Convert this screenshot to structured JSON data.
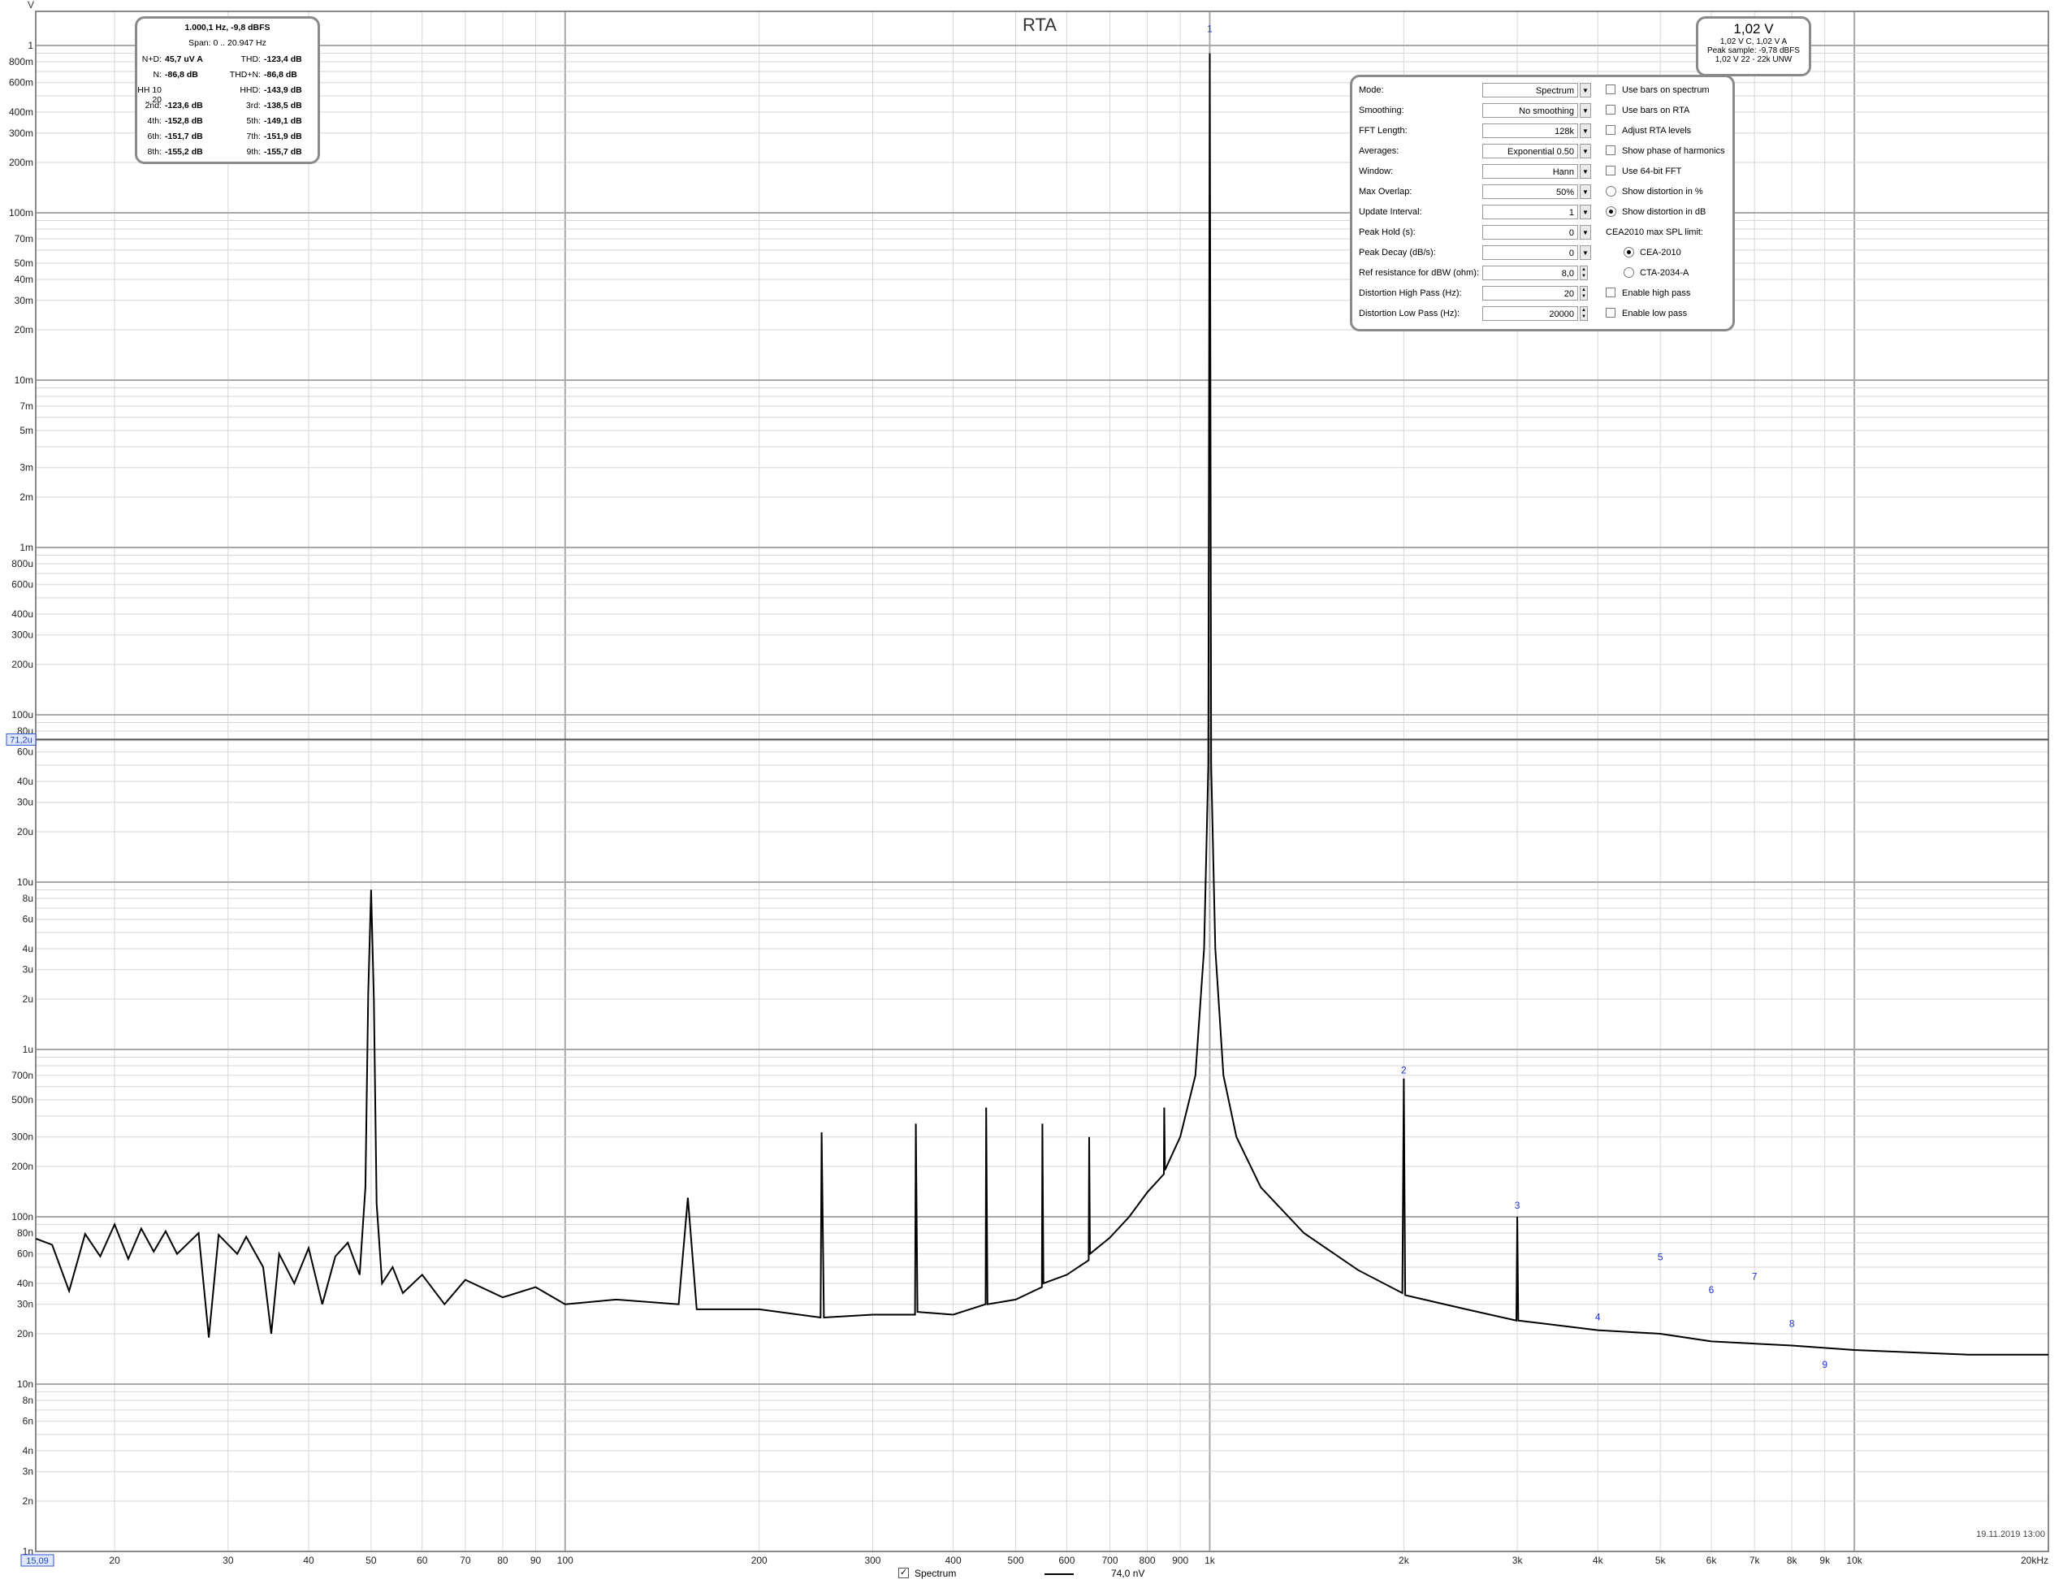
{
  "title": "RTA",
  "y_unit": "V",
  "stats": {
    "header": "1.000,1 Hz, -9,8 dBFS",
    "span": "Span:  0 .. 20.947 Hz",
    "rows": [
      [
        "N+D:",
        "45,7 uV A",
        "THD:",
        "-123,4 dB"
      ],
      [
        "N:",
        "-86,8 dB",
        "THD+N:",
        "-86,8 dB"
      ],
      [
        "HH 10 .. 20",
        "",
        "HHD:",
        "-143,9 dB"
      ],
      [
        "2nd:",
        "-123,6 dB",
        "3rd:",
        "-138,5 dB"
      ],
      [
        "4th:",
        "-152,8 dB",
        "5th:",
        "-149,1 dB"
      ],
      [
        "6th:",
        "-151,7 dB",
        "7th:",
        "-151,9 dB"
      ],
      [
        "8th:",
        "-155,2 dB",
        "9th:",
        "-155,7 dB"
      ]
    ]
  },
  "level_panel": {
    "main": "1,02 V",
    "line1": "1,02 V C, 1,02 V A",
    "line2": "Peak sample: -9,78 dBFS",
    "line3": "1,02 V 22 - 22k UNW"
  },
  "controls": {
    "rows": [
      {
        "label": "Mode:",
        "value": "Spectrum",
        "ctl": "drop",
        "opt": {
          "kind": "check",
          "label": "Use bars on spectrum",
          "on": false
        }
      },
      {
        "label": "Smoothing:",
        "value": "No  smoothing",
        "ctl": "drop",
        "opt": {
          "kind": "check",
          "label": "Use bars on RTA",
          "on": false
        }
      },
      {
        "label": "FFT Length:",
        "value": "128k",
        "ctl": "drop",
        "opt": {
          "kind": "check",
          "label": "Adjust RTA levels",
          "on": false
        }
      },
      {
        "label": "Averages:",
        "value": "Exponential 0.50",
        "ctl": "drop",
        "opt": {
          "kind": "check",
          "label": "Show phase of harmonics",
          "on": false
        }
      },
      {
        "label": "Window:",
        "value": "Hann",
        "ctl": "drop",
        "opt": {
          "kind": "check",
          "label": "Use 64-bit FFT",
          "on": false
        }
      },
      {
        "label": "Max Overlap:",
        "value": "50%",
        "ctl": "drop",
        "opt": {
          "kind": "radio",
          "label": "Show distortion in %",
          "on": false
        }
      },
      {
        "label": "Update Interval:",
        "value": "1",
        "ctl": "drop",
        "opt": {
          "kind": "radio",
          "label": "Show distortion in dB",
          "on": true
        }
      },
      {
        "label": "Peak Hold (s):",
        "value": "0",
        "ctl": "drop",
        "opt": {
          "kind": "text",
          "label": "CEA2010 max SPL limit:",
          "on": false
        }
      },
      {
        "label": "Peak Decay (dB/s):",
        "value": "0",
        "ctl": "drop",
        "opt": {
          "kind": "radio2",
          "label": "CEA-2010",
          "on": true
        }
      },
      {
        "label": "Ref resistance for dBW (ohm):",
        "value": "8,0",
        "ctl": "spin",
        "opt": {
          "kind": "radio2",
          "label": "CTA-2034-A",
          "on": false
        }
      },
      {
        "label": "Distortion High Pass (Hz):",
        "value": "20",
        "ctl": "spin",
        "opt": {
          "kind": "check",
          "label": "Enable high pass",
          "on": false
        }
      },
      {
        "label": "Distortion Low Pass (Hz):",
        "value": "20000",
        "ctl": "spin",
        "opt": {
          "kind": "check",
          "label": "Enable low pass",
          "on": false
        }
      }
    ]
  },
  "cursor": {
    "y_label": "71,2u",
    "x_label": "15,09"
  },
  "legend": {
    "checkbox_label": "Spectrum",
    "value": "74,0 nV"
  },
  "timestamp": "19.11.2019 13:00",
  "chart_data": {
    "type": "line",
    "x_scale": "log",
    "y_scale": "log",
    "xlim": [
      15.09,
      20000
    ],
    "ylim": [
      1e-09,
      1.6
    ],
    "x_tick_labels": [
      {
        "v": 20,
        "t": "20"
      },
      {
        "v": 30,
        "t": "30"
      },
      {
        "v": 40,
        "t": "40"
      },
      {
        "v": 50,
        "t": "50"
      },
      {
        "v": 60,
        "t": "60"
      },
      {
        "v": 70,
        "t": "70"
      },
      {
        "v": 80,
        "t": "80"
      },
      {
        "v": 90,
        "t": "90"
      },
      {
        "v": 100,
        "t": "100"
      },
      {
        "v": 200,
        "t": "200"
      },
      {
        "v": 300,
        "t": "300"
      },
      {
        "v": 400,
        "t": "400"
      },
      {
        "v": 500,
        "t": "500"
      },
      {
        "v": 600,
        "t": "600"
      },
      {
        "v": 700,
        "t": "700"
      },
      {
        "v": 800,
        "t": "800"
      },
      {
        "v": 900,
        "t": "900"
      },
      {
        "v": 1000,
        "t": "1k"
      },
      {
        "v": 2000,
        "t": "2k"
      },
      {
        "v": 3000,
        "t": "3k"
      },
      {
        "v": 4000,
        "t": "4k"
      },
      {
        "v": 5000,
        "t": "5k"
      },
      {
        "v": 6000,
        "t": "6k"
      },
      {
        "v": 7000,
        "t": "7k"
      },
      {
        "v": 8000,
        "t": "8k"
      },
      {
        "v": 9000,
        "t": "9k"
      },
      {
        "v": 10000,
        "t": "10k"
      },
      {
        "v": 20000,
        "t": "20kHz"
      }
    ],
    "y_tick_labels": [
      {
        "v": 1,
        "t": "1"
      },
      {
        "v": 0.8,
        "t": "800m"
      },
      {
        "v": 0.6,
        "t": "600m"
      },
      {
        "v": 0.4,
        "t": "400m"
      },
      {
        "v": 0.3,
        "t": "300m"
      },
      {
        "v": 0.2,
        "t": "200m"
      },
      {
        "v": 0.1,
        "t": "100m"
      },
      {
        "v": 0.07,
        "t": "70m"
      },
      {
        "v": 0.05,
        "t": "50m"
      },
      {
        "v": 0.04,
        "t": "40m"
      },
      {
        "v": 0.03,
        "t": "30m"
      },
      {
        "v": 0.02,
        "t": "20m"
      },
      {
        "v": 0.01,
        "t": "10m"
      },
      {
        "v": 0.007,
        "t": "7m"
      },
      {
        "v": 0.005,
        "t": "5m"
      },
      {
        "v": 0.003,
        "t": "3m"
      },
      {
        "v": 0.002,
        "t": "2m"
      },
      {
        "v": 0.001,
        "t": "1m"
      },
      {
        "v": 0.0008,
        "t": "800u"
      },
      {
        "v": 0.0006,
        "t": "600u"
      },
      {
        "v": 0.0004,
        "t": "400u"
      },
      {
        "v": 0.0003,
        "t": "300u"
      },
      {
        "v": 0.0002,
        "t": "200u"
      },
      {
        "v": 0.0001,
        "t": "100u"
      },
      {
        "v": 8e-05,
        "t": "80u"
      },
      {
        "v": 6e-05,
        "t": "60u"
      },
      {
        "v": 4e-05,
        "t": "40u"
      },
      {
        "v": 3e-05,
        "t": "30u"
      },
      {
        "v": 2e-05,
        "t": "20u"
      },
      {
        "v": 1e-05,
        "t": "10u"
      },
      {
        "v": 8e-06,
        "t": "8u"
      },
      {
        "v": 6e-06,
        "t": "6u"
      },
      {
        "v": 4e-06,
        "t": "4u"
      },
      {
        "v": 3e-06,
        "t": "3u"
      },
      {
        "v": 2e-06,
        "t": "2u"
      },
      {
        "v": 1e-06,
        "t": "1u"
      },
      {
        "v": 7e-07,
        "t": "700n"
      },
      {
        "v": 5e-07,
        "t": "500n"
      },
      {
        "v": 3e-07,
        "t": "300n"
      },
      {
        "v": 2e-07,
        "t": "200n"
      },
      {
        "v": 1e-07,
        "t": "100n"
      },
      {
        "v": 8e-08,
        "t": "80n"
      },
      {
        "v": 6e-08,
        "t": "60n"
      },
      {
        "v": 4e-08,
        "t": "40n"
      },
      {
        "v": 3e-08,
        "t": "30n"
      },
      {
        "v": 2e-08,
        "t": "20n"
      },
      {
        "v": 1e-08,
        "t": "10n"
      },
      {
        "v": 8e-09,
        "t": "8n"
      },
      {
        "v": 6e-09,
        "t": "6n"
      },
      {
        "v": 4e-09,
        "t": "4n"
      },
      {
        "v": 3e-09,
        "t": "3n"
      },
      {
        "v": 2e-09,
        "t": "2n"
      },
      {
        "v": 1e-09,
        "t": "1n"
      }
    ],
    "cursor": {
      "x": 15.09,
      "y": 7.12e-05
    },
    "series": [
      {
        "color": "#000000",
        "points": [
          [
            15.1,
            7.4e-08
          ],
          [
            16,
            6.8e-08
          ],
          [
            17,
            3.6e-08
          ],
          [
            18,
            7.9e-08
          ],
          [
            19,
            5.8e-08
          ],
          [
            20,
            9e-08
          ],
          [
            21,
            5.6e-08
          ],
          [
            22,
            8.5e-08
          ],
          [
            23,
            6.2e-08
          ],
          [
            24,
            8.2e-08
          ],
          [
            25,
            6e-08
          ],
          [
            27,
            8e-08
          ],
          [
            28,
            1.9e-08
          ],
          [
            29,
            7.8e-08
          ],
          [
            31,
            6e-08
          ],
          [
            32,
            7.6e-08
          ],
          [
            34,
            5e-08
          ],
          [
            35,
            2e-08
          ],
          [
            36,
            6e-08
          ],
          [
            38,
            4e-08
          ],
          [
            40,
            6.5e-08
          ],
          [
            42,
            3e-08
          ],
          [
            44,
            5.8e-08
          ],
          [
            46,
            7e-08
          ],
          [
            48,
            4.5e-08
          ],
          [
            49,
            1.5e-07
          ],
          [
            49.5,
            2.2e-06
          ],
          [
            50,
            9e-06
          ],
          [
            50.5,
            2e-06
          ],
          [
            51,
            1.2e-07
          ],
          [
            52,
            4e-08
          ],
          [
            54,
            5e-08
          ],
          [
            56,
            3.5e-08
          ],
          [
            60,
            4.5e-08
          ],
          [
            65,
            3e-08
          ],
          [
            70,
            4.2e-08
          ],
          [
            80,
            3.3e-08
          ],
          [
            90,
            3.8e-08
          ],
          [
            100,
            3e-08
          ],
          [
            120,
            3.2e-08
          ],
          [
            150,
            3e-08
          ],
          [
            155,
            1.3e-07
          ],
          [
            160,
            2.8e-08
          ],
          [
            200,
            2.8e-08
          ],
          [
            249,
            2.5e-08
          ],
          [
            250,
            3.2e-07
          ],
          [
            252,
            2.5e-08
          ],
          [
            300,
            2.6e-08
          ],
          [
            349,
            2.6e-08
          ],
          [
            350,
            3.6e-07
          ],
          [
            352,
            2.7e-08
          ],
          [
            400,
            2.6e-08
          ],
          [
            449,
            3e-08
          ],
          [
            450,
            4.5e-07
          ],
          [
            452,
            3e-08
          ],
          [
            500,
            3.2e-08
          ],
          [
            549,
            3.8e-08
          ],
          [
            550,
            3.6e-07
          ],
          [
            552,
            4e-08
          ],
          [
            600,
            4.5e-08
          ],
          [
            649,
            5.5e-08
          ],
          [
            650,
            3e-07
          ],
          [
            652,
            6e-08
          ],
          [
            700,
            7.5e-08
          ],
          [
            750,
            1e-07
          ],
          [
            800,
            1.4e-07
          ],
          [
            849,
            1.8e-07
          ],
          [
            850,
            4.5e-07
          ],
          [
            852,
            1.9e-07
          ],
          [
            900,
            3e-07
          ],
          [
            950,
            7e-07
          ],
          [
            980,
            4e-06
          ],
          [
            995,
            5e-05
          ],
          [
            1000,
            0.9
          ],
          [
            1005,
            5e-05
          ],
          [
            1020,
            4e-06
          ],
          [
            1050,
            7e-07
          ],
          [
            1100,
            3e-07
          ],
          [
            1200,
            1.5e-07
          ],
          [
            1400,
            8e-08
          ],
          [
            1700,
            4.8e-08
          ],
          [
            1990,
            3.5e-08
          ],
          [
            2000,
            6.7e-07
          ],
          [
            2010,
            3.4e-08
          ],
          [
            2500,
            2.8e-08
          ],
          [
            2990,
            2.4e-08
          ],
          [
            3000,
            1e-07
          ],
          [
            3010,
            2.4e-08
          ],
          [
            4000,
            2.1e-08
          ],
          [
            5000,
            2e-08
          ],
          [
            6000,
            1.8e-08
          ],
          [
            8000,
            1.7e-08
          ],
          [
            10000,
            1.6e-08
          ],
          [
            15000,
            1.5e-08
          ],
          [
            20000,
            1.5e-08
          ]
        ]
      }
    ],
    "harmonic_markers": [
      {
        "label": "1",
        "x": 1000,
        "y": 1.2
      },
      {
        "label": "2",
        "x": 2000,
        "y": 7.2e-07
      },
      {
        "label": "3",
        "x": 3000,
        "y": 1.12e-07
      },
      {
        "label": "4",
        "x": 4000,
        "y": 2.4e-08
      },
      {
        "label": "5",
        "x": 5000,
        "y": 5.5e-08
      },
      {
        "label": "6",
        "x": 6000,
        "y": 3.5e-08
      },
      {
        "label": "7",
        "x": 7000,
        "y": 4.2e-08
      },
      {
        "label": "8",
        "x": 8000,
        "y": 2.2e-08
      },
      {
        "label": "9",
        "x": 9000,
        "y": 1.25e-08
      }
    ]
  }
}
